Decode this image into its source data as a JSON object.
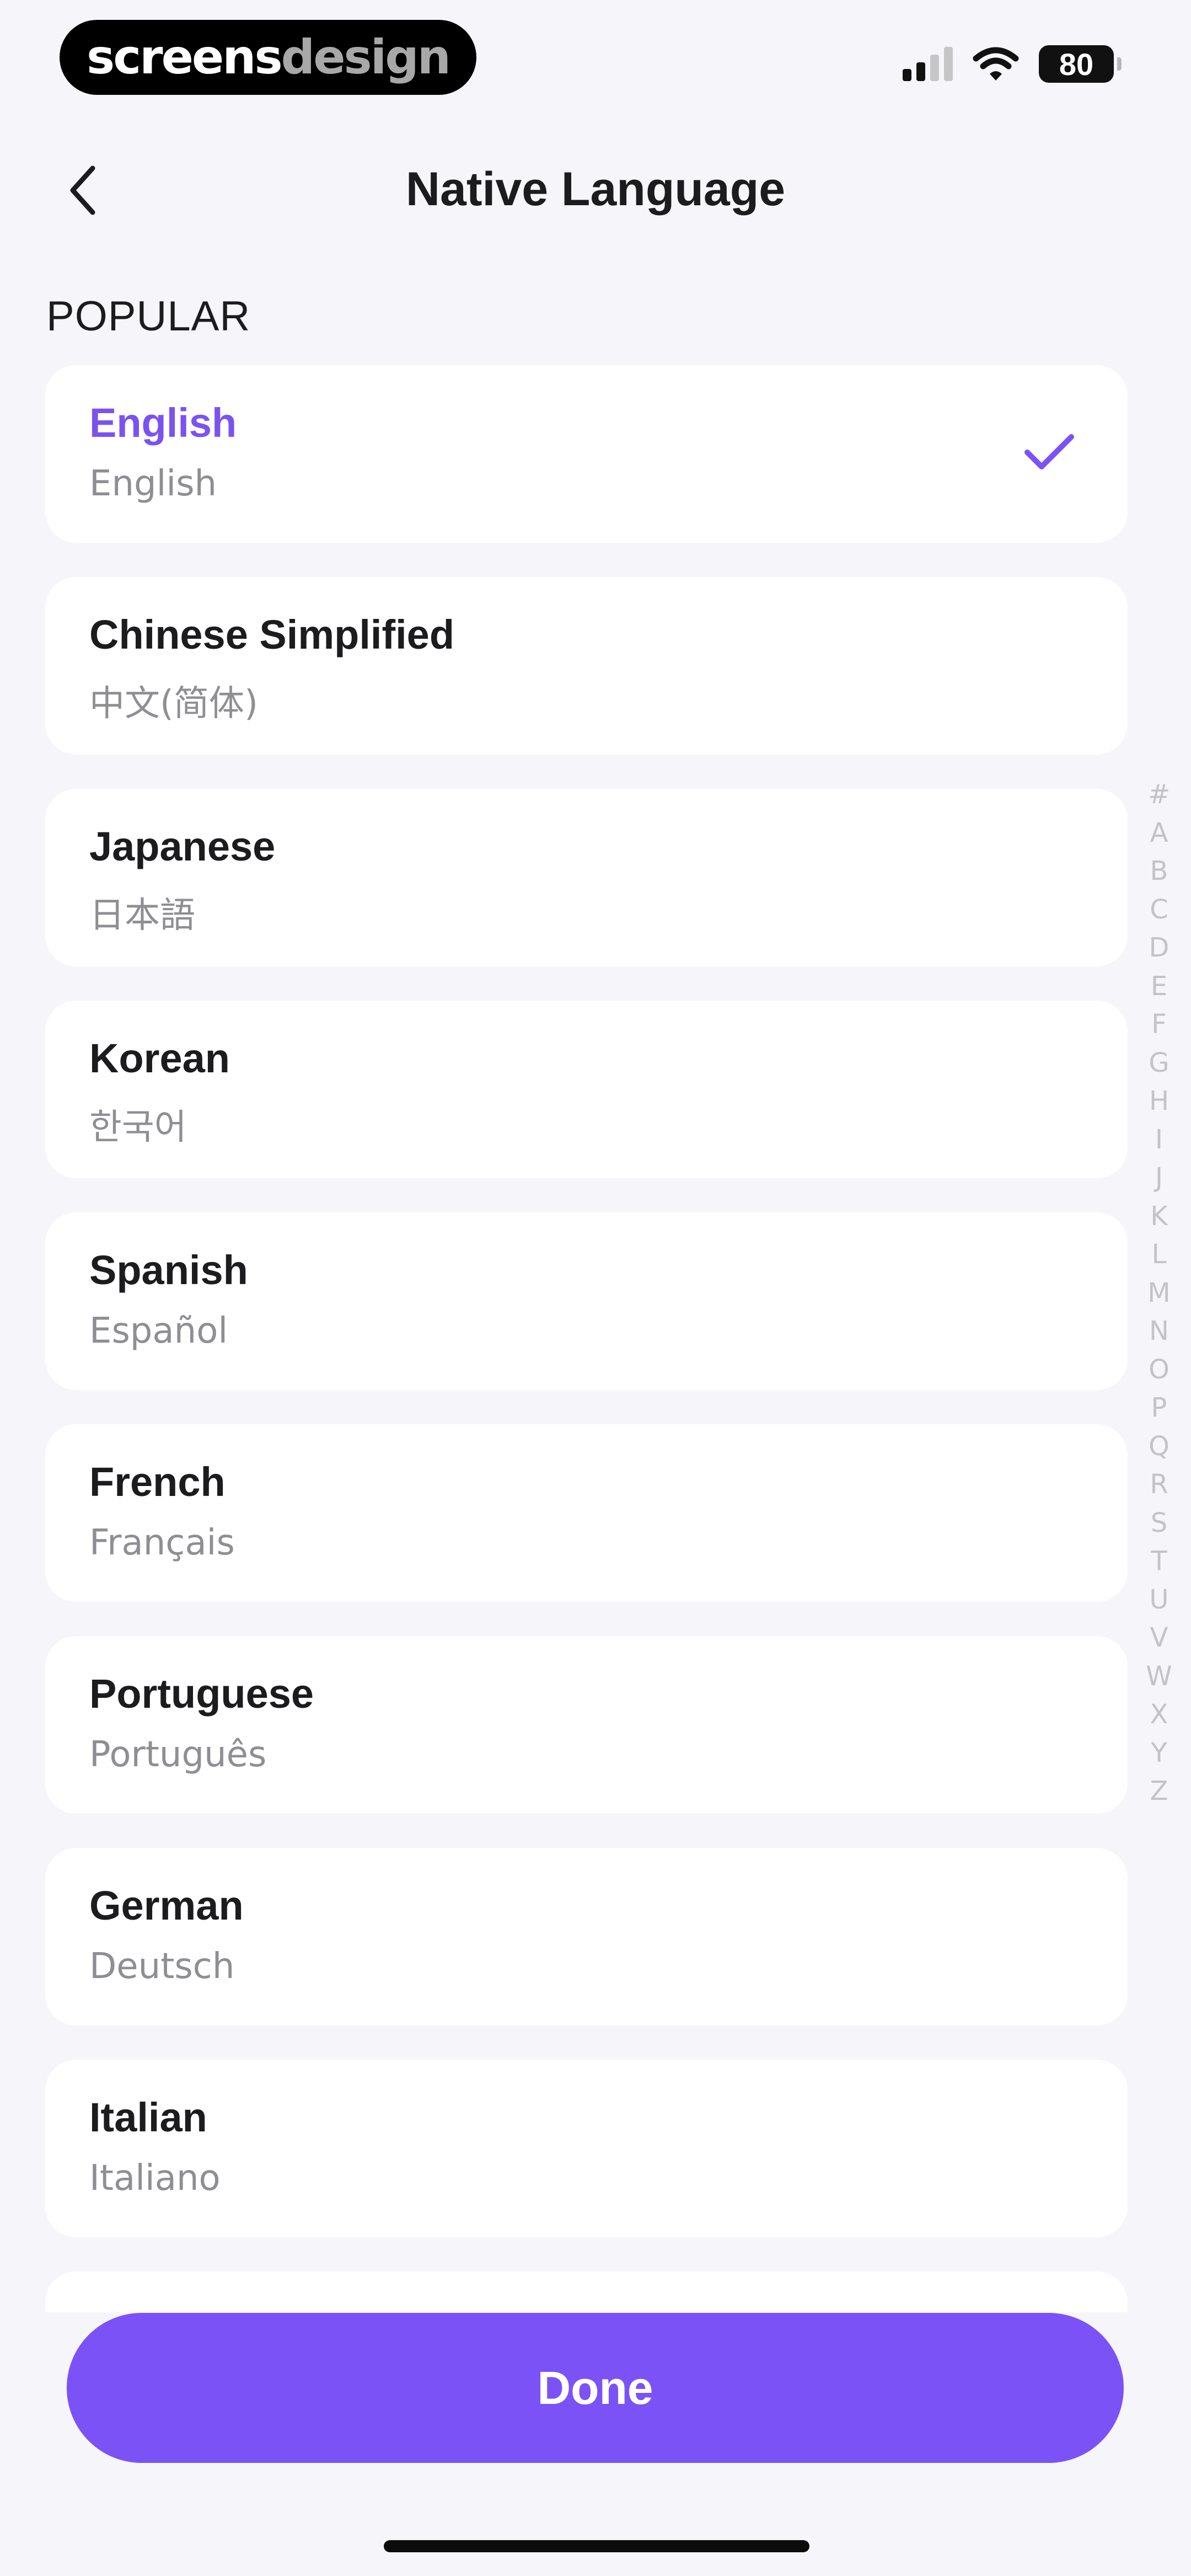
{
  "status_bar": {
    "brand_part1": "screens",
    "brand_part2": "design",
    "battery": "80",
    "icons": [
      "signal-icon",
      "wifi-icon",
      "battery-icon"
    ]
  },
  "nav": {
    "title": "Native Language",
    "back_icon": "chevron-left-icon"
  },
  "section": {
    "header": "POPULAR"
  },
  "languages": [
    {
      "name": "English",
      "native": "English",
      "selected": true
    },
    {
      "name": "Chinese Simplified",
      "native": "中文(简体)"
    },
    {
      "name": "Japanese",
      "native": "日本語"
    },
    {
      "name": "Korean",
      "native": "한국어"
    },
    {
      "name": "Spanish",
      "native": "Español"
    },
    {
      "name": "French",
      "native": "Français"
    },
    {
      "name": "Portuguese",
      "native": "Português"
    },
    {
      "name": "German",
      "native": "Deutsch"
    },
    {
      "name": "Italian",
      "native": "Italiano"
    }
  ],
  "index": [
    "#",
    "A",
    "B",
    "C",
    "D",
    "E",
    "F",
    "G",
    "H",
    "I",
    "J",
    "K",
    "L",
    "M",
    "N",
    "O",
    "P",
    "Q",
    "R",
    "S",
    "T",
    "U",
    "V",
    "W",
    "X",
    "Y",
    "Z"
  ],
  "done_label": "Done",
  "colors": {
    "accent": "#7b52f6",
    "background": "#f6f5f9",
    "card": "#ffffff",
    "secondary_text": "#8e8e93"
  }
}
